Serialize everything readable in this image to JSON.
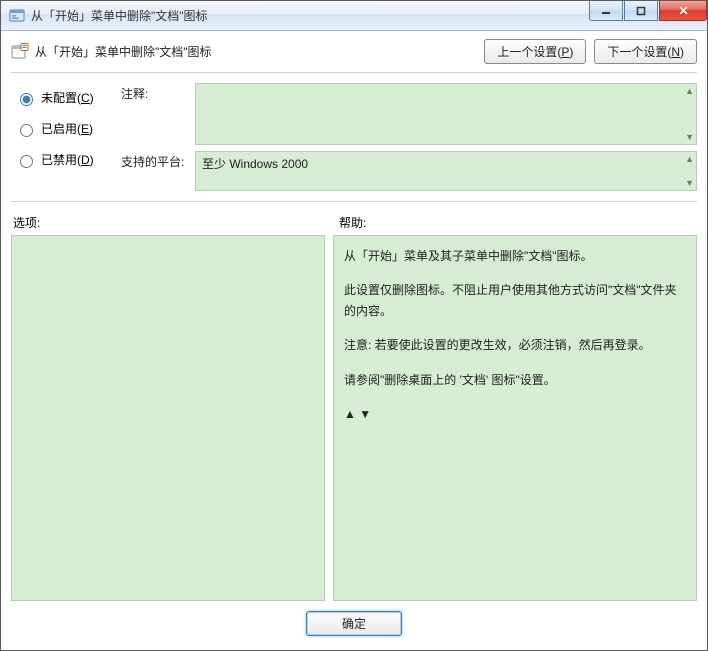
{
  "window": {
    "title": "从「开始」菜单中删除\"文档\"图标"
  },
  "header": {
    "policy_title": "从「开始」菜单中删除\"文档\"图标",
    "prev_label_pre": "上一个设置(",
    "prev_key": "P",
    "prev_label_post": ")",
    "next_label_pre": "下一个设置(",
    "next_key": "N",
    "next_label_post": ")"
  },
  "radios": {
    "not_configured_pre": "未配置(",
    "not_configured_key": "C",
    "not_configured_post": ")",
    "enabled_pre": "已启用(",
    "enabled_key": "E",
    "enabled_post": ")",
    "disabled_pre": "已禁用(",
    "disabled_key": "D",
    "disabled_post": ")",
    "selected": "not_configured"
  },
  "fields": {
    "comment_label": "注释:",
    "comment_value": "",
    "platform_label": "支持的平台:",
    "platform_value": "至少 Windows 2000"
  },
  "sections": {
    "options_label": "选项:",
    "help_label": "帮助:"
  },
  "help": {
    "p1": "从「开始」菜单及其子菜单中删除\"文档\"图标。",
    "p2": "此设置仅删除图标。不阻止用户使用其他方式访问\"文档\"文件夹的内容。",
    "p3": "注意: 若要使此设置的更改生效，必须注销，然后再登录。",
    "p4": "请参阅\"删除桌面上的 '文档' 图标\"设置。"
  },
  "footer": {
    "ok_label": "确定"
  },
  "colors": {
    "panel_bg": "#d6ecd3",
    "panel_border": "#b8ccb8"
  }
}
